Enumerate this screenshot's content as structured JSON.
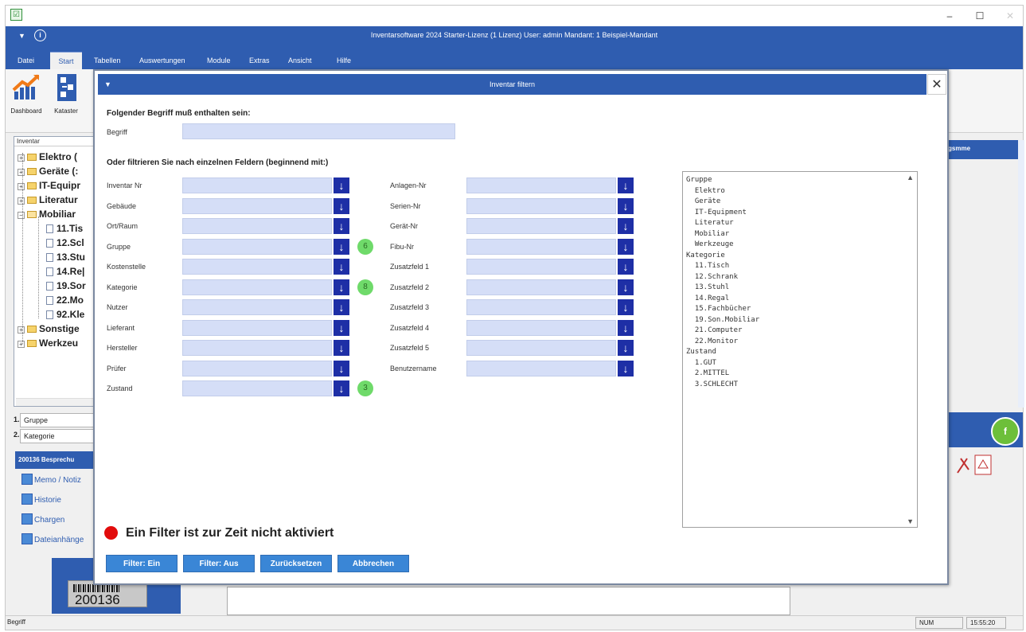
{
  "os": {
    "app_icon": "excel-like-icon",
    "minimize": "–",
    "maximize": "☐",
    "close": "✕"
  },
  "app": {
    "title": "Inventarsoftware 2024 Starter-Lizenz (1 Lizenz)   User: admin   Mandant: 1 Beispiel-Mandant",
    "menu": [
      "Datei",
      "Start",
      "Tabellen",
      "Auswertungen",
      "Module",
      "Extras",
      "Ansicht",
      "Hilfe"
    ],
    "active_menu": "Start"
  },
  "ribbon": {
    "dashboard_label": "Dashboard",
    "kataster_label": "Kataster"
  },
  "tree": {
    "header": "Inventar",
    "items": [
      {
        "label": "Elektro  (",
        "kind": "folder"
      },
      {
        "label": "Geräte  (:",
        "kind": "folder"
      },
      {
        "label": "IT-Equipr",
        "kind": "folder"
      },
      {
        "label": "Literatur",
        "kind": "folder"
      },
      {
        "label": "Mobiliar",
        "kind": "folder-open"
      },
      {
        "label": "11.Tis",
        "kind": "doc"
      },
      {
        "label": "12.Scl",
        "kind": "doc"
      },
      {
        "label": "13.Stu",
        "kind": "doc"
      },
      {
        "label": "14.Re|",
        "kind": "doc"
      },
      {
        "label": "19.Sor",
        "kind": "doc"
      },
      {
        "label": "22.Mo",
        "kind": "doc"
      },
      {
        "label": "92.Kle",
        "kind": "doc"
      },
      {
        "label": "Sonstige",
        "kind": "folder"
      },
      {
        "label": "Werkzeu",
        "kind": "folder"
      }
    ]
  },
  "sort": [
    {
      "num": "1.",
      "value": "Gruppe"
    },
    {
      "num": "2.",
      "value": "Kategorie"
    }
  ],
  "record": {
    "header": "200136 Besprechu",
    "links": [
      "Memo / Notiz",
      "Historie",
      "Chargen",
      "Dateianhänge"
    ],
    "barcode_number": "200136"
  },
  "right": {
    "header": "gsmme",
    "badge": "f"
  },
  "statusbar": {
    "left": "Begriff",
    "num": "NUM",
    "time": "15:55:20"
  },
  "dialog": {
    "title": "Inventar filtern",
    "close": "✕",
    "section1": "Folgender Begriff muß enthalten sein:",
    "begriff_label": "Begriff",
    "begriff_value": "",
    "section2": "Oder filtrieren Sie nach einzelnen Feldern (beginnend mit:)",
    "left_fields": [
      {
        "label": "Inventar Nr",
        "badge": ""
      },
      {
        "label": "Gebäude",
        "badge": ""
      },
      {
        "label": "Ort/Raum",
        "badge": ""
      },
      {
        "label": "Gruppe",
        "badge": "6"
      },
      {
        "label": "Kostenstelle",
        "badge": ""
      },
      {
        "label": "Kategorie",
        "badge": "8"
      },
      {
        "label": "Nutzer",
        "badge": ""
      },
      {
        "label": "Lieferant",
        "badge": ""
      },
      {
        "label": "Hersteller",
        "badge": ""
      },
      {
        "label": "Prüfer",
        "badge": ""
      },
      {
        "label": "Zustand",
        "badge": "3"
      }
    ],
    "right_fields": [
      {
        "label": "Anlagen-Nr"
      },
      {
        "label": "Serien-Nr"
      },
      {
        "label": "Gerät-Nr"
      },
      {
        "label": "Fibu-Nr"
      },
      {
        "label": "Zusatzfeld 1"
      },
      {
        "label": "Zusatzfeld 2"
      },
      {
        "label": "Zusatzfeld 3"
      },
      {
        "label": "Zusatzfeld 4"
      },
      {
        "label": "Zusatzfeld 5"
      },
      {
        "label": "Benutzername"
      }
    ],
    "dropdown_glyph": "↓",
    "values_list": [
      "Gruppe",
      "  Elektro",
      "  Geräte",
      "  IT-Equipment",
      "  Literatur",
      "  Mobiliar",
      "  Werkzeuge",
      "Kategorie",
      "  11.Tisch",
      "  12.Schrank",
      "  13.Stuhl",
      "  14.Regal",
      "  15.Fachbücher",
      "  19.Son.Mobiliar",
      "  21.Computer",
      "  22.Monitor",
      "Zustand",
      "  1.GUT",
      "  2.MITTEL",
      "  3.SCHLECHT"
    ],
    "scroll_up": "▲",
    "scroll_down": "▼",
    "filter_status": "Ein Filter ist zur Zeit nicht aktiviert",
    "filter_status_color": "#e20c0c",
    "buttons": {
      "on": "Filter: Ein",
      "off": "Filter: Aus",
      "reset": "Zurücksetzen",
      "cancel": "Abbrechen"
    }
  }
}
